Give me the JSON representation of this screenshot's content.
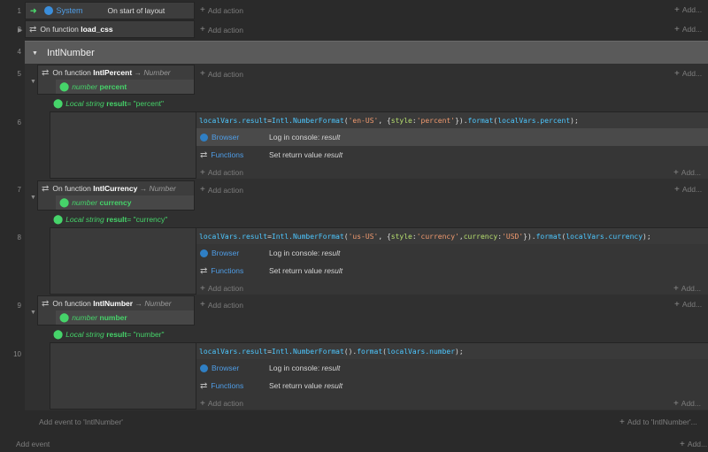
{
  "row_numbers": [
    "1",
    "2",
    "4",
    "5",
    "6",
    "7",
    "8",
    "9",
    "10"
  ],
  "common": {
    "add_action": "Add action",
    "add_right": "Add...",
    "browser_label": "Browser",
    "functions_label": "Functions",
    "log_console": "Log in console: ",
    "log_console_arg": "result",
    "set_return": "Set return value ",
    "set_return_arg": "result",
    "on_function": "On function ",
    "arrow_number": "→ Number"
  },
  "event1": {
    "object": "System",
    "condition": "On start of layout"
  },
  "event2": {
    "label": "On function ",
    "name": "load_css"
  },
  "group": {
    "title": "IntlNumber"
  },
  "functions": [
    {
      "name": "IntlPercent",
      "param_type": "number",
      "param_name": "percent",
      "local_prefix": "Local string",
      "local_name": "result",
      "local_value": " = \"percent\"",
      "code": {
        "a": "localVars.result",
        "b": " = ",
        "c": "Intl.NumberFormat",
        "d": "(",
        "e": "'en-US'",
        "f": ", {",
        "g": "style",
        "h": ": ",
        "i": "'percent'",
        "j": "}).",
        "k": "format",
        "l": "(",
        "m": "localVars.percent",
        "n": ");"
      }
    },
    {
      "name": "IntlCurrency",
      "param_type": "number",
      "param_name": "currency",
      "local_prefix": "Local string",
      "local_name": "result",
      "local_value": " = \"currency\"",
      "code": {
        "a": "localVars.result",
        "b": " = ",
        "c": "Intl.NumberFormat",
        "d": "(",
        "e": "'us-US'",
        "f": ", {",
        "g": "style",
        "h": ": ",
        "i": "'currency'",
        "j": ", ",
        "k": "currency",
        "l": ": ",
        "m": "'USD'",
        "n": "}).",
        "o": "format",
        "p": "(",
        "q": "localVars.currency",
        "r": ");"
      }
    },
    {
      "name": "IntlNumber",
      "param_type": "number",
      "param_name": "number",
      "local_prefix": "Local string",
      "local_name": "result",
      "local_value": " = \"number\"",
      "code": {
        "a": "localVars.result",
        "b": " = ",
        "c": "Intl.NumberFormat",
        "d": "().",
        "e": "format",
        "f": "(",
        "g": "localVars.number",
        "h": ");"
      }
    }
  ],
  "footer": {
    "add_event_to": "Add event to 'IntlNumber'",
    "add_to_right": "Add to 'IntlNumber'...",
    "add_event": "Add event",
    "add_right": "Add..."
  },
  "colors": {
    "accent_blue": "#4f9de6",
    "green": "#46d46a",
    "background": "#2a2a2a"
  }
}
